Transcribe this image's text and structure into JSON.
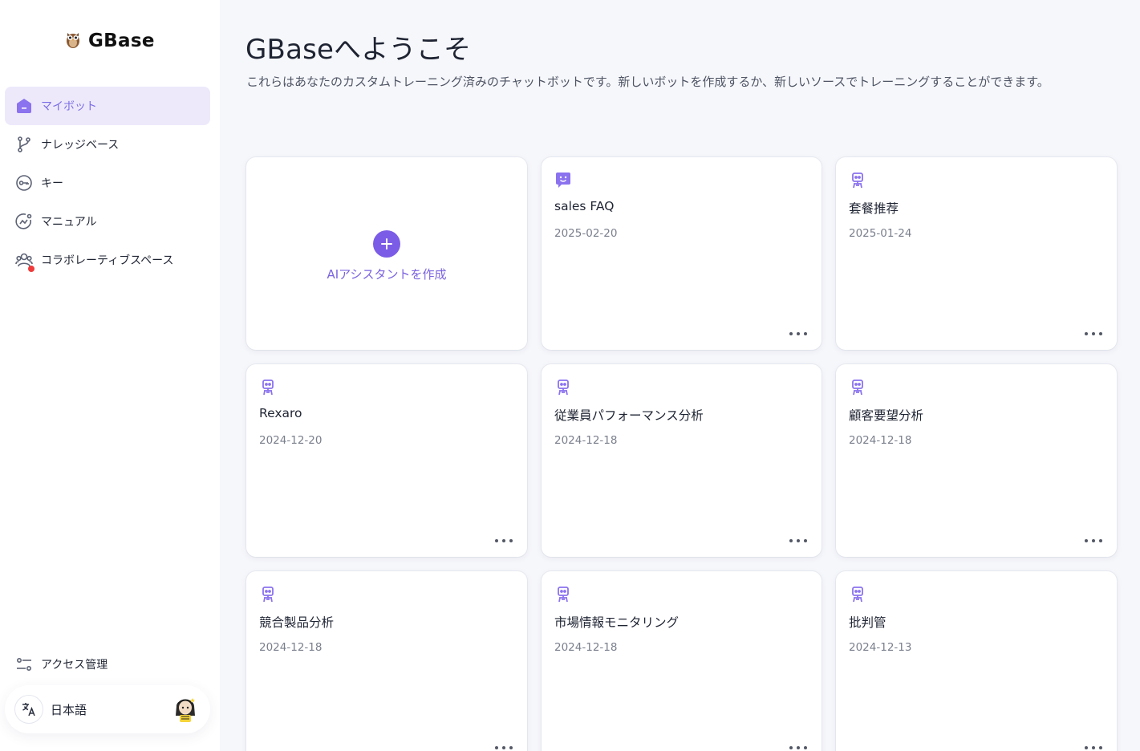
{
  "sidebar": {
    "logo_text": "GBase",
    "items": [
      {
        "label": "マイボット",
        "icon": "bot-home-icon",
        "active": true
      },
      {
        "label": "ナレッジベース",
        "icon": "branch-icon"
      },
      {
        "label": "キー",
        "icon": "key-icon"
      },
      {
        "label": "マニュアル",
        "icon": "chart-icon"
      },
      {
        "label": "コラボレーティブスペース",
        "icon": "users-icon",
        "badge": true
      }
    ],
    "access_label": "アクセス管理",
    "language_label": "日本語"
  },
  "main": {
    "title": "GBaseへようこそ",
    "subtitle": "これらはあなたのカスタムトレーニング済みのチャットボットです。新しいボットを作成するか、新しいソースでトレーニングすることができます。",
    "create_label": "AIアシスタントを作成",
    "bots": [
      {
        "name": "sales FAQ",
        "date": "2025-02-20",
        "icon": "chat-bubble-icon"
      },
      {
        "name": "套餐推荐",
        "date": "2025-01-24",
        "icon": "robot-icon"
      },
      {
        "name": "Rexaro",
        "date": "2024-12-20",
        "icon": "robot-icon"
      },
      {
        "name": "従業員パフォーマンス分析",
        "date": "2024-12-18",
        "icon": "robot-icon"
      },
      {
        "name": "顧客要望分析",
        "date": "2024-12-18",
        "icon": "robot-icon"
      },
      {
        "name": "競合製品分析",
        "date": "2024-12-18",
        "icon": "robot-icon"
      },
      {
        "name": "市場情報モニタリング",
        "date": "2024-12-18",
        "icon": "robot-icon"
      },
      {
        "name": "批判管",
        "date": "2024-12-13",
        "icon": "robot-icon"
      }
    ]
  },
  "colors": {
    "accent": "#7b5ce6",
    "active_bg": "#ede9fb",
    "page_bg": "#f6f7fb",
    "badge": "#ef3b3b"
  }
}
